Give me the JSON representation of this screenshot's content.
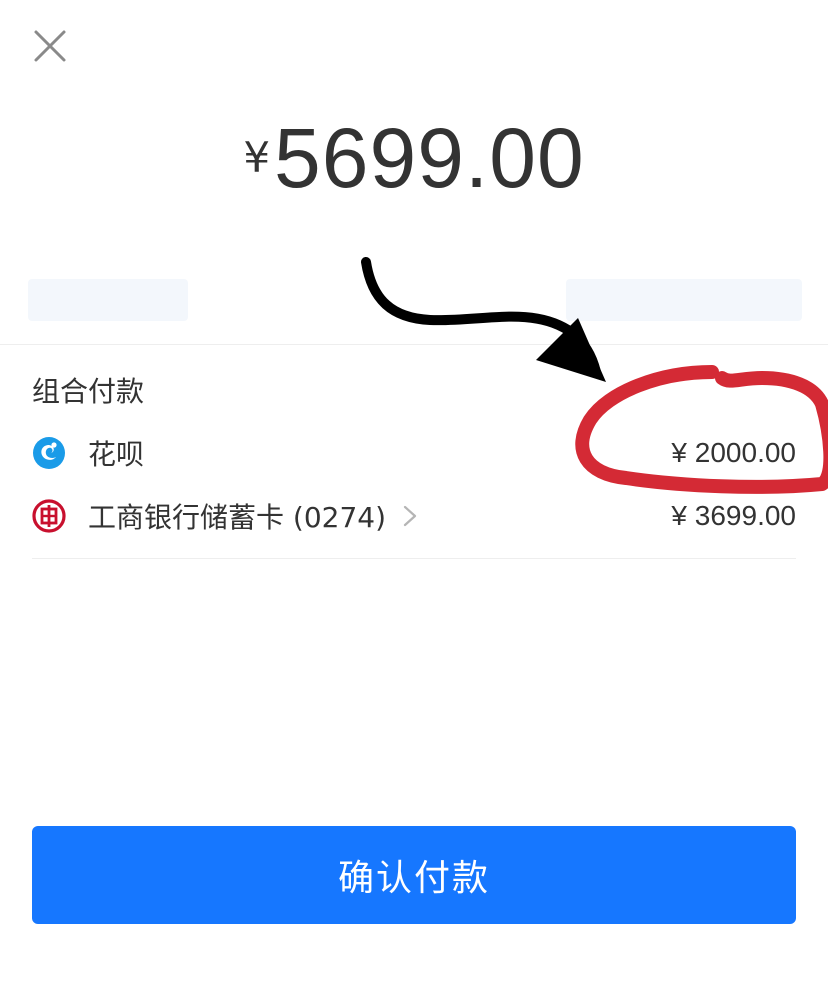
{
  "header": {
    "close_icon": "close-icon"
  },
  "amount": {
    "currency": "¥",
    "value": "5699.00"
  },
  "combined_payment": {
    "title": "组合付款",
    "items": [
      {
        "icon": "huabei-icon",
        "label": "花呗",
        "amount": "¥ 2000.00",
        "color": "#1a9be8"
      },
      {
        "icon": "icbc-icon",
        "label": "工商银行储蓄卡 (0274)",
        "amount": "¥ 3699.00",
        "color": "#c8102e"
      }
    ]
  },
  "confirm_button": {
    "label": "确认付款",
    "color": "#1677ff"
  },
  "annotation": {
    "arrow_color": "#000000",
    "circle_color": "#d42a35"
  }
}
